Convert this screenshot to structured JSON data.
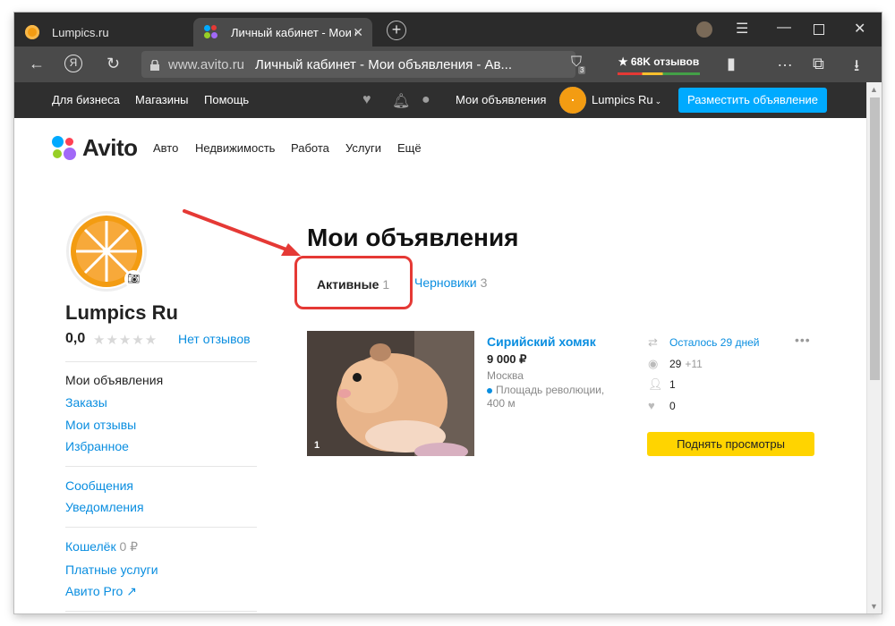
{
  "browser": {
    "tabs": [
      {
        "title": "Lumpics.ru",
        "active": false
      },
      {
        "title": "Личный кабинет - Мои объявления",
        "active": true
      }
    ],
    "url_host": "www.avito.ru",
    "url_title": "Личный кабинет - Мои объявления - Ав...",
    "extension_badge": "3",
    "reviews_pill": "★ 68K отзывов"
  },
  "topbar": {
    "for_business": "Для бизнеса",
    "shops": "Магазины",
    "help": "Помощь",
    "my_ads": "Мои объявления",
    "user_name": "Lumpics Ru",
    "post_button": "Разместить объявление"
  },
  "site_nav": {
    "logo": "Avito",
    "categories": [
      "Авто",
      "Недвижимость",
      "Работа",
      "Услуги",
      "Ещё"
    ]
  },
  "profile": {
    "name": "Lumpics Ru",
    "rating": "0,0",
    "no_reviews": "Нет отзывов",
    "menu_groups": [
      [
        "Мои объявления",
        "Заказы",
        "Мои отзывы",
        "Избранное"
      ],
      [
        "Сообщения",
        "Уведомления"
      ],
      [
        "Кошелёк",
        "Платные услуги",
        "Авито Pro ↗"
      ]
    ],
    "wallet_amount": "0 ₽"
  },
  "main": {
    "title": "Мои объявления",
    "tabs": [
      {
        "label": "Активные",
        "count": "1"
      },
      {
        "label": "Черновики",
        "count": "3"
      }
    ]
  },
  "listing": {
    "title": "Сирийский хомяк",
    "price": "9 000 ₽",
    "city": "Москва",
    "metro": "Площадь революции, 400 м",
    "photo_count": "1",
    "days_left": "Осталось 29 дней",
    "views": "29",
    "views_today": "+11",
    "contacts": "1",
    "favorites": "0",
    "boost_button": "Поднять просмотры"
  },
  "colors": {
    "accent_blue": "#0a8ee0",
    "post_button": "#00aaff",
    "boost_button": "#ffd400",
    "highlight": "#e53935"
  }
}
